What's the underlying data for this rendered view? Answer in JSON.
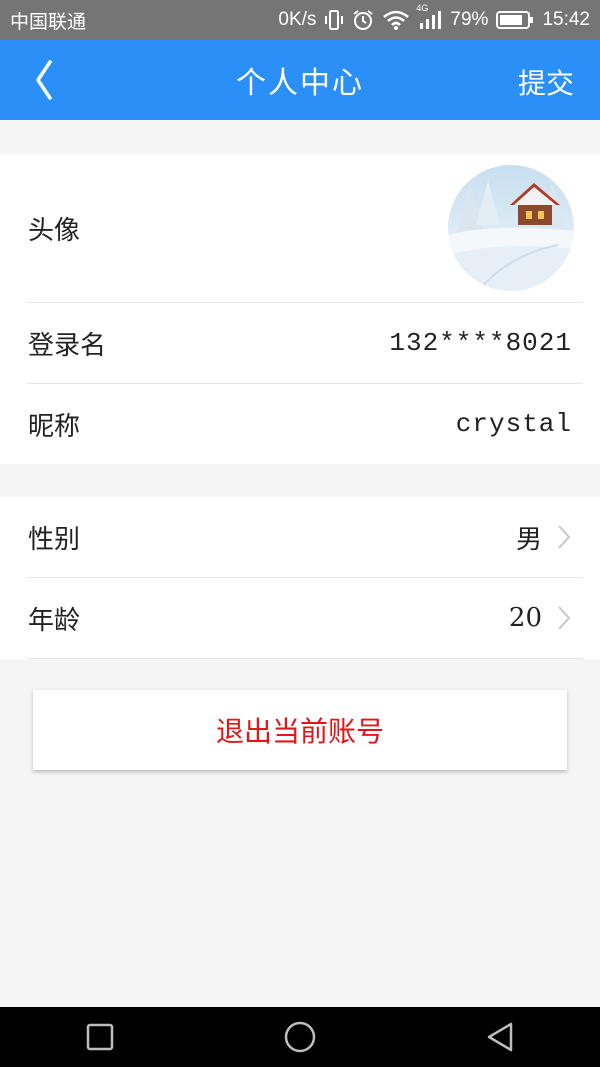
{
  "status_bar": {
    "carrier": "中国联通",
    "speed": "0K/s",
    "network": "4G",
    "battery": "79%",
    "time": "15:42"
  },
  "navbar": {
    "back_icon": "chevron-left-icon",
    "title": "个人中心",
    "submit_label": "提交"
  },
  "profile": {
    "avatar_label": "头像",
    "login_label": "登录名",
    "login_value": "132****8021",
    "nickname_label": "昵称",
    "nickname_value": "crystal"
  },
  "details": {
    "gender_label": "性别",
    "gender_value": "男",
    "age_label": "年龄",
    "age_value": "20"
  },
  "logout_label": "退出当前账号",
  "colors": {
    "navbar": "#2a8ff7",
    "logout_text": "#e5141b",
    "status_bar": "#757575"
  }
}
